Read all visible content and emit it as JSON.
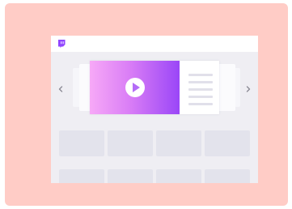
{
  "app": {
    "brand": "Twitch",
    "logo_icon": "twitch-logo-icon",
    "accent_color": "#9146ff"
  },
  "carousel": {
    "prev_icon": "chevron-left-icon",
    "next_icon": "chevron-right-icon",
    "featured": {
      "play_icon": "play-icon",
      "gradient": [
        "#f7a9f7",
        "#d97df6",
        "#9a46f7"
      ]
    }
  },
  "grid": {
    "rows": 2,
    "columns": 4,
    "tile_color": "#e3e3ec"
  }
}
